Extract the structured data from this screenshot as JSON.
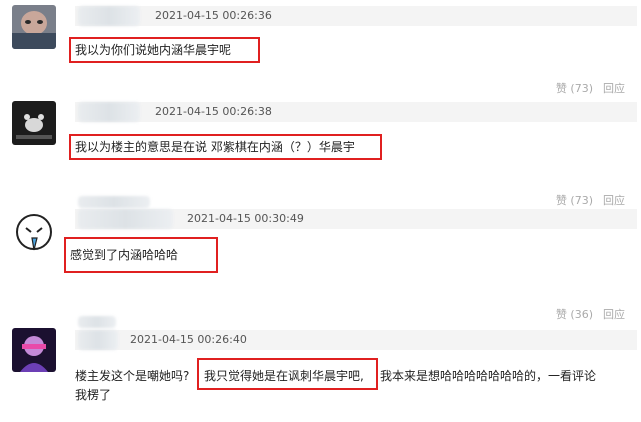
{
  "comments": [
    {
      "timestamp": "2021-04-15 00:26:36",
      "text": "我以为你们说她内涵华晨宇呢",
      "likes_label": "赞 (73)",
      "reply_label": "回应"
    },
    {
      "timestamp": "2021-04-15 00:26:38",
      "text": "我以为楼主的意思是在说 邓紫棋在内涵（？）华晨宇",
      "likes_label": "赞 (73)",
      "reply_label": "回应"
    },
    {
      "timestamp": "2021-04-15 00:30:49",
      "text": "感觉到了内涵哈哈哈",
      "likes_label": "赞 (36)",
      "reply_label": "回应"
    },
    {
      "timestamp": "2021-04-15 00:26:40",
      "text_part1": "楼主发这个是嘲她吗?",
      "text_highlight": "我只觉得她是在讽刺华晨宇吧,",
      "text_part2": "我本来是想哈哈哈哈哈哈哈的，一看评论",
      "text_line2": "我楞了"
    }
  ],
  "colors": {
    "highlight": "#e02020",
    "meta_bg": "#f4f4f4"
  }
}
